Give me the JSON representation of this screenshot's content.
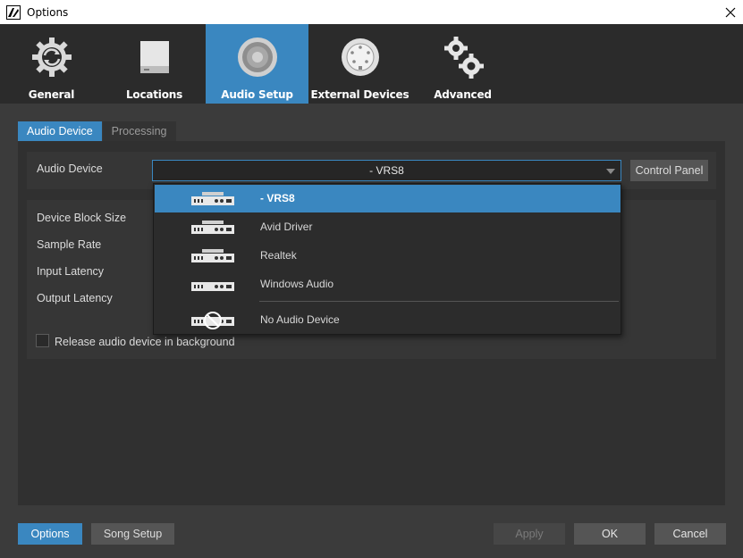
{
  "window": {
    "title": "Options"
  },
  "nav": [
    {
      "label": "General",
      "icon": "gear-sync-icon"
    },
    {
      "label": "Locations",
      "icon": "drive-icon"
    },
    {
      "label": "Audio Setup",
      "icon": "speaker-icon",
      "active": true
    },
    {
      "label": "External Devices",
      "icon": "midi-port-icon"
    },
    {
      "label": "Advanced",
      "icon": "gears-icon"
    }
  ],
  "tabs": [
    {
      "label": "Audio Device",
      "active": true
    },
    {
      "label": "Processing",
      "active": false
    }
  ],
  "device": {
    "label": "Audio Device",
    "selected": "- VRS8",
    "control_panel": "Control Panel"
  },
  "settings": {
    "block_size": "Device Block Size",
    "sample_rate": "Sample Rate",
    "input_latency": "Input Latency",
    "output_latency": "Output Latency",
    "release_label": "Release audio device in background",
    "release_checked": false
  },
  "dropdown": {
    "items": [
      {
        "label": "- VRS8",
        "selected": true
      },
      {
        "label": "Avid Driver"
      },
      {
        "label": "Realtek"
      },
      {
        "label": "Windows Audio"
      },
      {
        "label": "No Audio Device"
      }
    ]
  },
  "footer": {
    "options": "Options",
    "song_setup": "Song Setup",
    "apply": "Apply",
    "ok": "OK",
    "cancel": "Cancel"
  },
  "colors": {
    "accent": "#3a87c0",
    "background": "#2b2b2b",
    "panel": "#3b3b3b"
  }
}
